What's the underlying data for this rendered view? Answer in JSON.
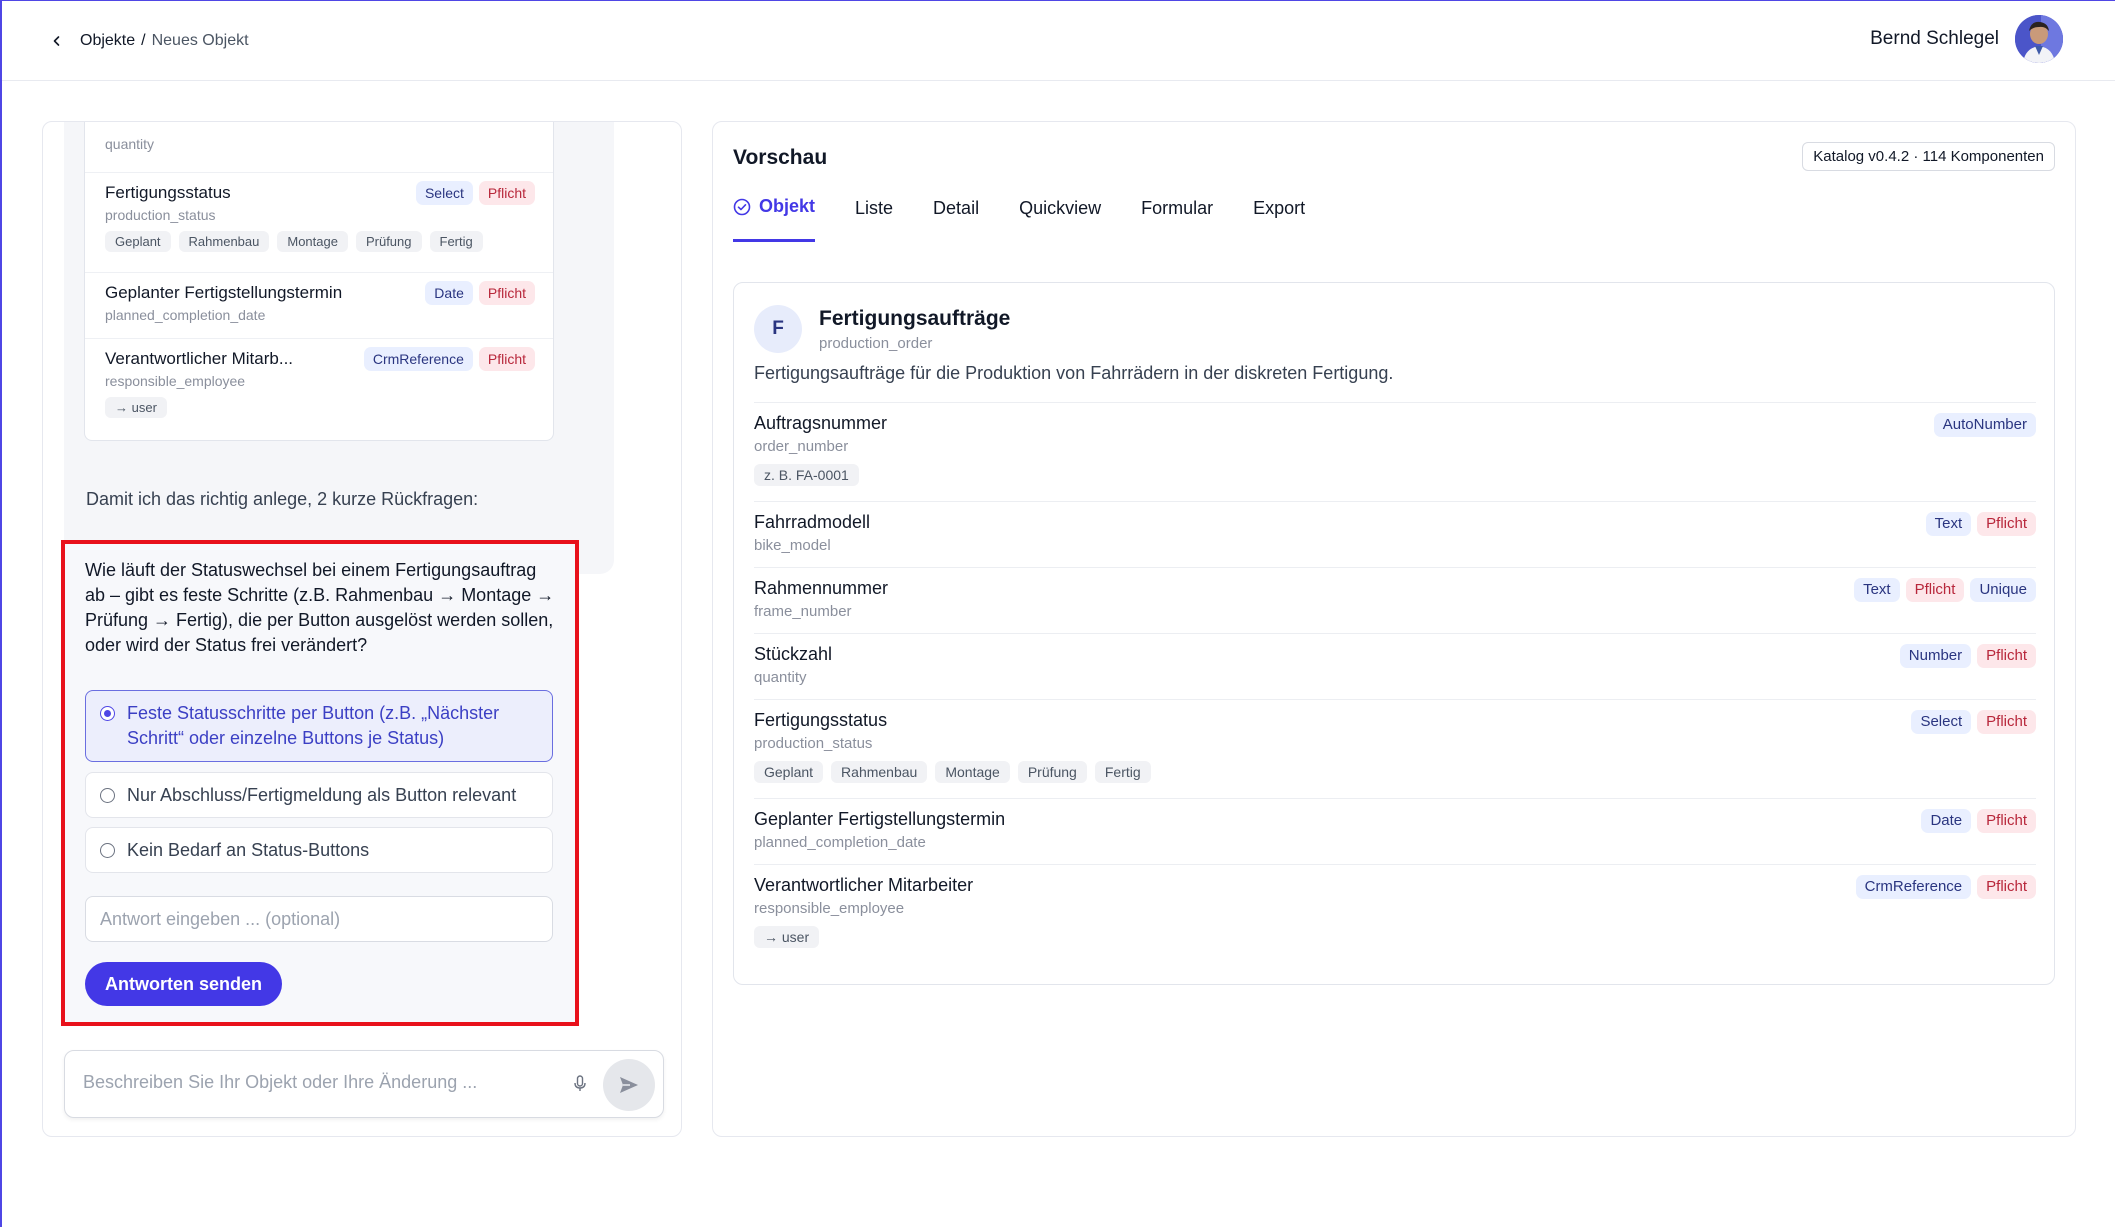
{
  "header": {
    "breadcrumb_parent": "Objekte",
    "breadcrumb_sep": "/",
    "breadcrumb_current": "Neues Objekt",
    "user_name": "Bernd Schlegel"
  },
  "chat": {
    "fields": [
      {
        "title": "",
        "key": "quantity",
        "tags": []
      },
      {
        "title": "Fertigungsstatus",
        "key": "production_status",
        "type": "Select",
        "required": "Pflicht",
        "chips": [
          "Geplant",
          "Rahmenbau",
          "Montage",
          "Prüfung",
          "Fertig"
        ]
      },
      {
        "title": "Geplanter Fertigstellungstermin",
        "key": "planned_completion_date",
        "type": "Date",
        "required": "Pflicht"
      },
      {
        "title": "Verantwortlicher Mitarb...",
        "key": "responsible_employee",
        "type": "CrmReference",
        "required": "Pflicht",
        "chips": [
          "→ user"
        ]
      }
    ],
    "assistant_message": "Damit ich das richtig anlege, 2 kurze Rückfragen:",
    "question": "Wie läuft der Statuswechsel bei einem Fertigungsauftrag ab – gibt es feste Schritte (z.B. Rahmenbau → Montage → Prüfung → Fertig), die per Button ausgelöst werden sollen, oder wird der Status frei verändert?",
    "options": [
      {
        "label": "Feste Statusschritte per Button (z.B. „Nächster Schritt“ oder einzelne Buttons je Status)",
        "selected": true
      },
      {
        "label": "Nur Abschluss/Fertigmeldung als Button relevant",
        "selected": false
      },
      {
        "label": "Kein Bedarf an Status-Buttons",
        "selected": false
      }
    ],
    "answer_placeholder": "Antwort eingeben ... (optional)",
    "send_answers_label": "Antworten senden",
    "composer_placeholder": "Beschreiben Sie Ihr Objekt oder Ihre Änderung ..."
  },
  "preview": {
    "title": "Vorschau",
    "catalog_badge": "Katalog v0.4.2 · 114 Komponenten",
    "tabs": [
      "Objekt",
      "Liste",
      "Detail",
      "Quickview",
      "Formular",
      "Export"
    ],
    "active_tab": "Objekt",
    "object": {
      "initial": "F",
      "name": "Fertigungsaufträge",
      "key": "production_order",
      "description": "Fertigungsaufträge für die Produktion von Fahrrädern in der diskreten Fertigung."
    },
    "fields": [
      {
        "title": "Auftragsnummer",
        "key": "order_number",
        "tags": [
          "AutoNumber"
        ],
        "chips": [
          "z. B. FA-0001"
        ]
      },
      {
        "title": "Fahrradmodell",
        "key": "bike_model",
        "tags": [
          "Text",
          "Pflicht"
        ]
      },
      {
        "title": "Rahmennummer",
        "key": "frame_number",
        "tags": [
          "Text",
          "Pflicht",
          "Unique"
        ]
      },
      {
        "title": "Stückzahl",
        "key": "quantity",
        "tags": [
          "Number",
          "Pflicht"
        ]
      },
      {
        "title": "Fertigungsstatus",
        "key": "production_status",
        "tags": [
          "Select",
          "Pflicht"
        ],
        "chips": [
          "Geplant",
          "Rahmenbau",
          "Montage",
          "Prüfung",
          "Fertig"
        ]
      },
      {
        "title": "Geplanter Fertigstellungstermin",
        "key": "planned_completion_date",
        "tags": [
          "Date",
          "Pflicht"
        ]
      },
      {
        "title": "Verantwortlicher Mitarbeiter",
        "key": "responsible_employee",
        "tags": [
          "CrmReference",
          "Pflicht"
        ],
        "chips": [
          "→ user"
        ]
      }
    ]
  },
  "colors": {
    "accent": "#4338e6",
    "highlight_border": "#e8111b",
    "required_bg": "#fde7ea",
    "type_bg": "#e9efff"
  }
}
